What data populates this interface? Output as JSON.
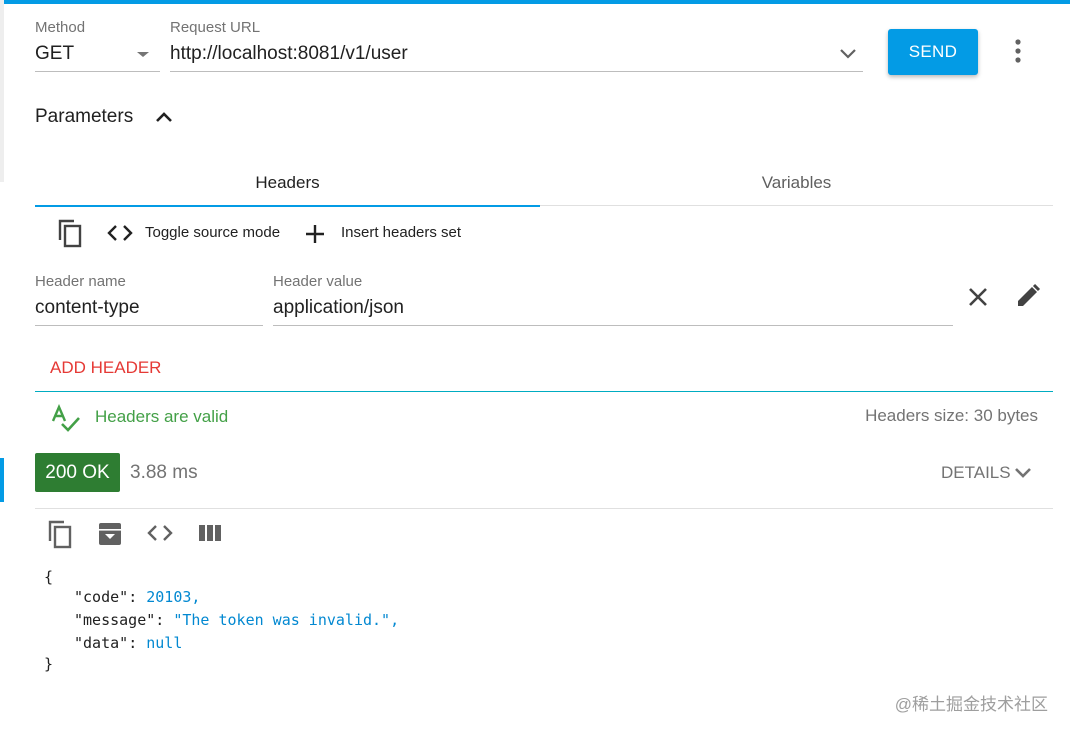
{
  "request": {
    "method_label": "Method",
    "method_value": "GET",
    "url_label": "Request URL",
    "url_value": "http://localhost:8081/v1/user",
    "send_label": "SEND"
  },
  "parameters": {
    "title": "Parameters"
  },
  "tabs": [
    {
      "label": "Headers",
      "active": true
    },
    {
      "label": "Variables",
      "active": false
    }
  ],
  "headers_toolbar": {
    "toggle_source_label": "Toggle source mode",
    "insert_set_label": "Insert headers set"
  },
  "header_row": {
    "name_label": "Header name",
    "name_value": "content-type",
    "value_label": "Header value",
    "value_value": "application/json"
  },
  "add_header_label": "ADD HEADER",
  "validation": {
    "status": "Headers are valid",
    "size": "Headers size: 30 bytes"
  },
  "response": {
    "status_badge": "200 OK",
    "time": "3.88 ms",
    "details_label": "DETAILS",
    "body": {
      "open_brace": "{",
      "close_brace": "}",
      "lines": [
        {
          "key": "\"code\"",
          "value": "20103",
          "comma": ","
        },
        {
          "key": "\"message\"",
          "value": "\"The token was invalid.\"",
          "comma": ","
        },
        {
          "key": "\"data\"",
          "value": "null",
          "comma": ""
        }
      ]
    }
  },
  "watermark": "@稀土掘金技术社区",
  "colors": {
    "accent": "#039be5",
    "success": "#2e7d32",
    "valid_text": "#43a047",
    "add_header": "#e53935",
    "json_value": "#0288d1"
  },
  "icons": [
    "chevron-down-icon",
    "more-vert-icon",
    "chevron-up-icon",
    "copy-icon",
    "code-icon",
    "plus-icon",
    "close-icon",
    "edit-icon",
    "spellcheck-icon",
    "archive-icon",
    "columns-icon"
  ]
}
